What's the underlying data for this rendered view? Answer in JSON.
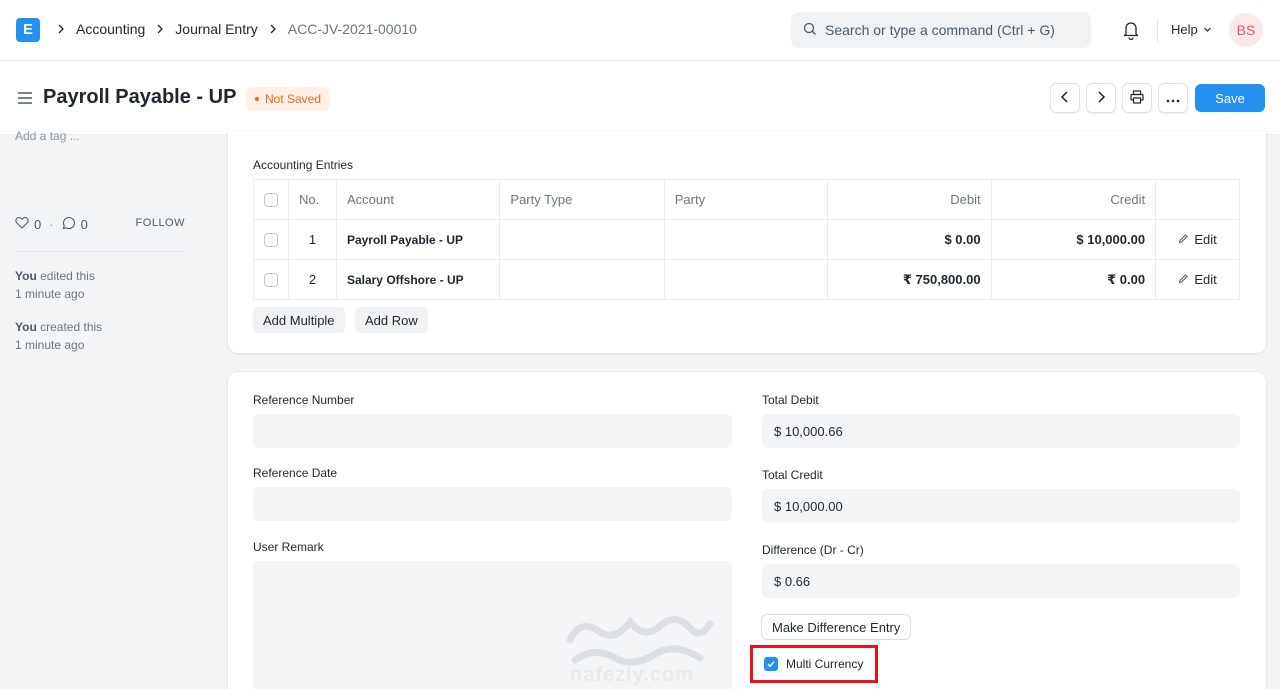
{
  "navbar": {
    "logo_letter": "E",
    "breadcrumbs": [
      "Accounting",
      "Journal Entry",
      "ACC-JV-2021-00010"
    ],
    "search_placeholder": "Search or type a command (Ctrl + G)",
    "help_label": "Help",
    "avatar_initials": "BS"
  },
  "page": {
    "title": "Payroll Payable - UP",
    "status": "Not Saved",
    "save_label": "Save"
  },
  "sidebar": {
    "tag_placeholder": "Add a tag ...",
    "likes": "0",
    "comments": "0",
    "follow_label": "FOLLOW",
    "activity": [
      {
        "who": "You",
        "action": "edited this",
        "when": "1 minute ago"
      },
      {
        "who": "You",
        "action": "created this",
        "when": "1 minute ago"
      }
    ]
  },
  "accounting_entries": {
    "label": "Accounting Entries",
    "columns": [
      "No.",
      "Account",
      "Party Type",
      "Party",
      "Debit",
      "Credit"
    ],
    "rows": [
      {
        "no": "1",
        "account": "Payroll Payable - UP",
        "party_type": "",
        "party": "",
        "debit": "$ 0.00",
        "credit": "$ 10,000.00",
        "edit": "Edit"
      },
      {
        "no": "2",
        "account": "Salary Offshore - UP",
        "party_type": "",
        "party": "",
        "debit": "₹ 750,800.00",
        "credit": "₹ 0.00",
        "edit": "Edit"
      }
    ],
    "add_multiple_label": "Add Multiple",
    "add_row_label": "Add Row"
  },
  "details": {
    "reference_number_label": "Reference Number",
    "reference_number_value": "",
    "reference_date_label": "Reference Date",
    "reference_date_value": "",
    "user_remark_label": "User Remark",
    "user_remark_value": "",
    "total_debit_label": "Total Debit",
    "total_debit_value": "$ 10,000.66",
    "total_credit_label": "Total Credit",
    "total_credit_value": "$ 10,000.00",
    "difference_label": "Difference (Dr - Cr)",
    "difference_value": "$ 0.66",
    "make_difference_label": "Make Difference Entry",
    "multi_currency_label": "Multi Currency",
    "multi_currency_checked": true
  },
  "watermark": {
    "text": "nafezly.com"
  },
  "colors": {
    "primary": "#2490ef",
    "status_orange": "#e86c13",
    "highlight_red": "#e8121b"
  }
}
